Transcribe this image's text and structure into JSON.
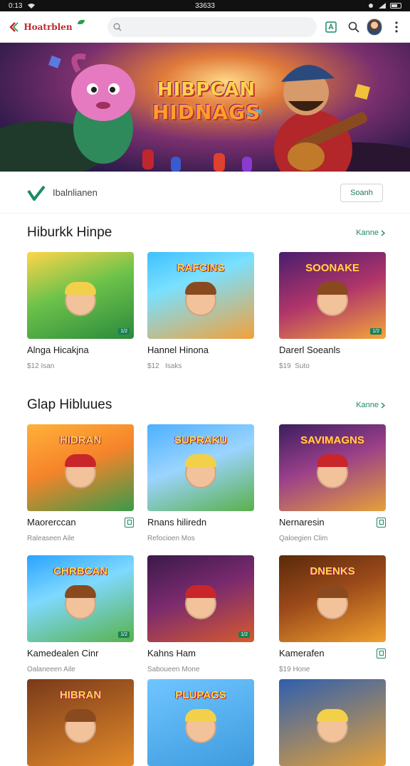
{
  "status_bar": {
    "time": "0:13",
    "center": "33633"
  },
  "app_bar": {
    "logo_text": "Hoatrblen",
    "logo_sub": "",
    "search_placeholder": "",
    "icons": [
      "back-icon",
      "tag-icon",
      "search-icon",
      "avatar",
      "more-vert-icon"
    ]
  },
  "hero": {
    "title_line1": "HIBPCAN",
    "title_line2": "HIDNAGS"
  },
  "featured": {
    "label": "Ibalnlianen",
    "button": "Soanh"
  },
  "section1": {
    "title": "Hiburkk Hinpe",
    "more": "Kanne",
    "items": [
      {
        "name": "Alnga Hicakjna",
        "meta": "$12  Isan",
        "thumb_title": "",
        "badge": "1/2"
      },
      {
        "name": "Hannel Hinona",
        "meta": "$12    Isaks",
        "thumb_title": "RAFCINS",
        "badge": ""
      },
      {
        "name": "Darerl Soeanls",
        "meta": "$19   Suto",
        "thumb_title": "SOONAKE",
        "badge": "1/2"
      }
    ]
  },
  "section2": {
    "title": "Glap Hibluues",
    "more": "Kanne",
    "items": [
      {
        "name": "Maorerccan",
        "meta": "Raleaseen Aile",
        "thumb_title": "HIDRAN",
        "badge": ""
      },
      {
        "name": "Rnans hiliredn",
        "meta": "Refocioen Mos",
        "thumb_title": "SUPRAKU",
        "badge": ""
      },
      {
        "name": "Nernaresin",
        "meta": "Qaloegien Clim",
        "thumb_title": "SAVIMAGNS",
        "badge": ""
      },
      {
        "name": "Kamedealen Cinr",
        "meta": "Oalaneeen Aile",
        "thumb_title": "CHRBCAN",
        "badge": "1/2"
      },
      {
        "name": "Kahns Ham",
        "meta": "Saboueen Mone",
        "thumb_title": "",
        "badge": "1/2"
      },
      {
        "name": "Kamerafen",
        "meta": "$19  Hone",
        "thumb_title": "DNENKS",
        "badge": ""
      }
    ]
  },
  "section3": {
    "items": [
      {
        "thumb_title": "HIBRAN"
      },
      {
        "thumb_title": "PLUPAGS"
      },
      {
        "thumb_title": ""
      }
    ]
  }
}
